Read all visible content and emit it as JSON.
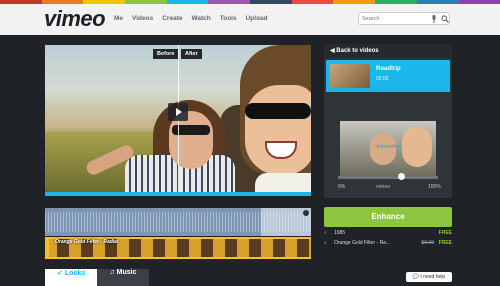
{
  "brand": {
    "logo": "vimeo",
    "stripe_colors": [
      "#c0392b",
      "#e67e22",
      "#f1c40f",
      "#8cc63e",
      "#1ab7ea",
      "#9b59b6",
      "#34495e",
      "#e74c3c",
      "#f39c12",
      "#27ae60",
      "#2980b9",
      "#8e44ad"
    ]
  },
  "nav": {
    "items": [
      "Me",
      "Videos",
      "Create",
      "Watch",
      "Tools",
      "Upload"
    ]
  },
  "search": {
    "placeholder": "Search"
  },
  "player": {
    "before_label": "Before",
    "after_label": "After",
    "progress": 1.0
  },
  "filter_track": {
    "label": "Orange Gold Filter - Radial"
  },
  "panel": {
    "back_label": "◀ Back to videos",
    "video_title": "Roadtrip",
    "video_duration": "02:56",
    "intensity_label": "Intensity",
    "intensity_value": 0.65,
    "min_label": "0%",
    "max_label": "100%",
    "watermark": "vimeo"
  },
  "enhance_label": "Enhance",
  "items": [
    {
      "icon": "♪",
      "name": "1985",
      "price": "",
      "status": "FREE"
    },
    {
      "icon": "♪",
      "name": "Orange Gold Filter - Ra...",
      "price": "$0.99",
      "status": "FREE"
    }
  ],
  "tabs": [
    {
      "label": "Looks",
      "icon": "✓"
    },
    {
      "label": "Music",
      "icon": "♫"
    }
  ],
  "help_label": "💬 I need help",
  "colors": {
    "accent": "#1ab7ea",
    "enhance": "#8cc63e",
    "background": "#1f2328"
  }
}
